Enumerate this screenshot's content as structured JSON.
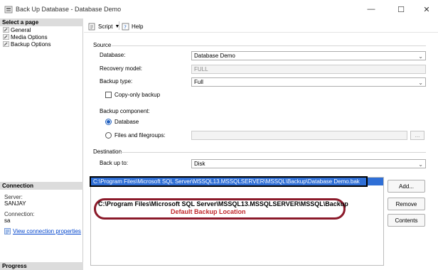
{
  "window": {
    "title": "Back Up Database - Database Demo",
    "controls": {
      "minimize": "—",
      "maximize": "☐",
      "close": "✕"
    }
  },
  "left_pane": {
    "select_page_header": "Select a page",
    "pages": [
      "General",
      "Media Options",
      "Backup Options"
    ],
    "connection_header": "Connection",
    "server_label": "Server:",
    "server_value": "SANJAY",
    "connection_label": "Connection:",
    "connection_value": "sa",
    "view_properties_link": "View connection properties",
    "progress_header": "Progress"
  },
  "toolbar": {
    "script_label": "Script",
    "help_label": "Help"
  },
  "source": {
    "group_label": "Source",
    "database_label": "Database:",
    "database_value": "Database Demo",
    "recovery_label": "Recovery model:",
    "recovery_value": "FULL",
    "backup_type_label": "Backup type:",
    "backup_type_value": "Full",
    "copy_only_label": "Copy-only backup",
    "copy_only_checked": false,
    "component_label": "Backup component:",
    "component_database": "Database",
    "component_files": "Files and filegroups:",
    "component_selected": "Database",
    "files_browse": "..."
  },
  "destination": {
    "group_label": "Destination",
    "backup_to_label": "Back up to:",
    "backup_to_value": "Disk",
    "paths": [
      "C:\\Program Files\\Microsoft SQL Server\\MSSQL13.MSSQLSERVER\\MSSQL\\Backup\\Database Demo.bak"
    ],
    "add_button": "Add...",
    "remove_button": "Remove",
    "contents_button": "Contents"
  },
  "annotation": {
    "path": "C:\\Program Files\\Microsoft SQL Server\\MSSQL13.MSSQLSERVER\\MSSQL\\Backup",
    "caption": "Default Backup Location"
  },
  "colors": {
    "selection": "#2f6fd6",
    "annotation_border": "#8b1a2a",
    "annotation_caption": "#c0282b",
    "link": "#0044cc"
  }
}
